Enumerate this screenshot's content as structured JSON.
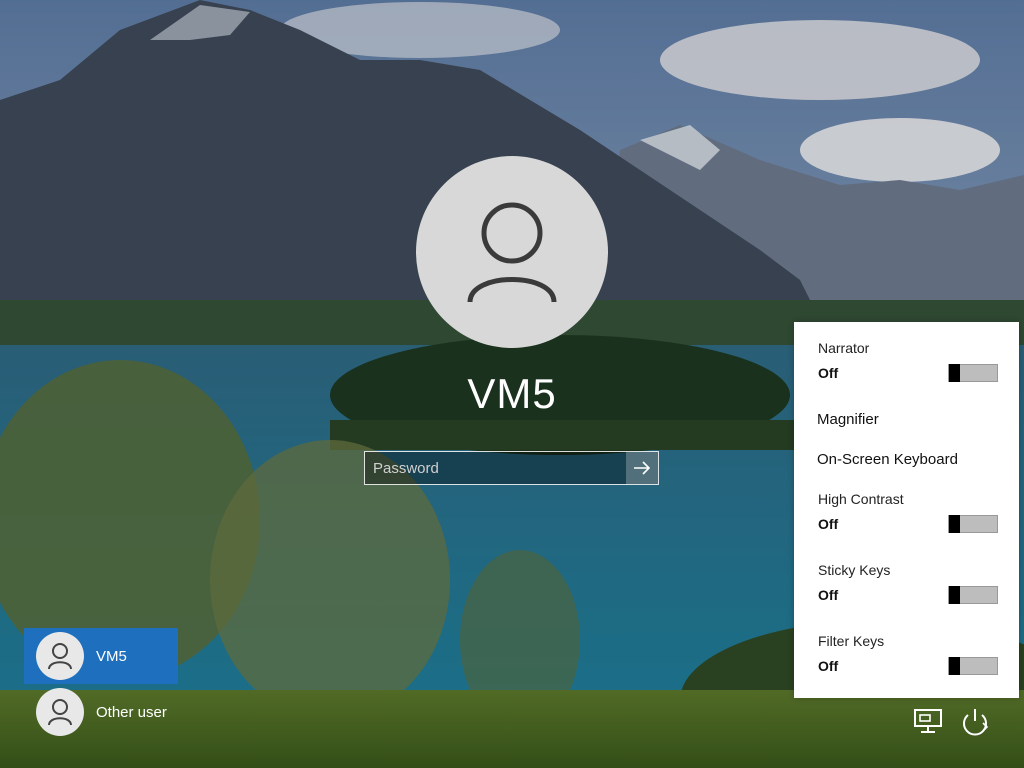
{
  "login": {
    "username": "VM5",
    "password_placeholder": "Password"
  },
  "users": [
    {
      "name": "VM5",
      "selected": true
    },
    {
      "name": "Other user",
      "selected": false
    }
  ],
  "ease_of_access": {
    "narrator": {
      "label": "Narrator",
      "state": "Off"
    },
    "magnifier": {
      "label": "Magnifier"
    },
    "on_screen_keyboard": {
      "label": "On-Screen Keyboard"
    },
    "high_contrast": {
      "label": "High Contrast",
      "state": "Off"
    },
    "sticky_keys": {
      "label": "Sticky Keys",
      "state": "Off"
    },
    "filter_keys": {
      "label": "Filter Keys",
      "state": "Off"
    }
  },
  "icons": {
    "network": "network-icon",
    "power": "power-icon",
    "arrow": "arrow-right-icon",
    "user": "user-icon"
  },
  "colors": {
    "selected_user": "#1e6fbd",
    "panel_bg": "#ffffff",
    "toggle_knob": "#000000",
    "toggle_track": "#bdbdbd"
  }
}
